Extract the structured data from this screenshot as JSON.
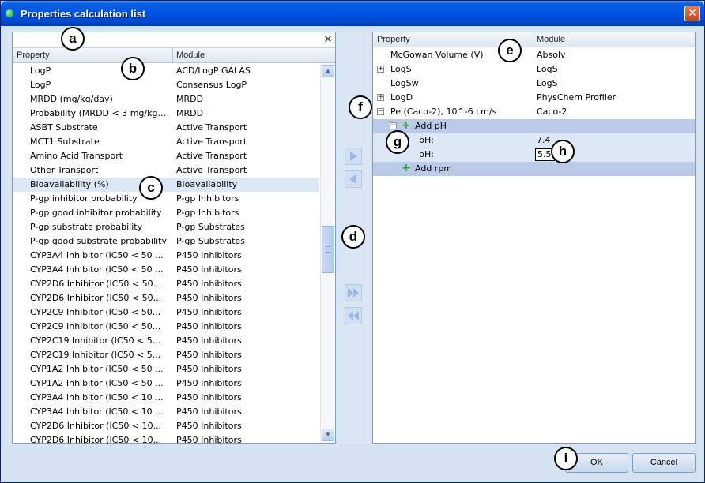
{
  "window": {
    "title": "Properties calculation list",
    "close_glyph": "✕"
  },
  "search": {
    "value": "",
    "clear_glyph": "✕"
  },
  "left_list": {
    "header": {
      "property": "Property",
      "module": "Module"
    },
    "rows": [
      {
        "property": "LogP",
        "module": "ACD/LogP GALAS"
      },
      {
        "property": "LogP",
        "module": "Consensus LogP"
      },
      {
        "property": "MRDD (mg/kg/day)",
        "module": "MRDD"
      },
      {
        "property": "Probability (MRDD < 3 mg/kg...",
        "module": "MRDD"
      },
      {
        "property": "ASBT Substrate",
        "module": "Active Transport"
      },
      {
        "property": "MCT1 Substrate",
        "module": "Active Transport"
      },
      {
        "property": "Amino Acid Transport",
        "module": "Active Transport"
      },
      {
        "property": "Other Transport",
        "module": "Active Transport"
      },
      {
        "property": "Bioavailability (%)",
        "module": "Bioavailability",
        "selected": true
      },
      {
        "property": "P-gp inhibitor probability",
        "module": "P-gp Inhibitors"
      },
      {
        "property": "P-gp good inhibitor probability",
        "module": "P-gp Inhibitors"
      },
      {
        "property": "P-gp substrate probability",
        "module": "P-gp Substrates"
      },
      {
        "property": "P-gp good substrate probability",
        "module": "P-gp Substrates"
      },
      {
        "property": "CYP3A4 Inhibitor (IC50 < 50 ...",
        "module": "P450 Inhibitors"
      },
      {
        "property": "CYP3A4 Inhibitor (IC50 < 50 ...",
        "module": "P450 Inhibitors"
      },
      {
        "property": "CYP2D6 Inhibitor (IC50 < 50...",
        "module": "P450 Inhibitors"
      },
      {
        "property": "CYP2D6 Inhibitor (IC50 < 50...",
        "module": "P450 Inhibitors"
      },
      {
        "property": "CYP2C9 Inhibitor (IC50 < 50...",
        "module": "P450 Inhibitors"
      },
      {
        "property": "CYP2C9 Inhibitor (IC50 < 50...",
        "module": "P450 Inhibitors"
      },
      {
        "property": "CYP2C19 Inhibitor (IC50 < 5...",
        "module": "P450 Inhibitors"
      },
      {
        "property": "CYP2C19 Inhibitor (IC50 < 5...",
        "module": "P450 Inhibitors"
      },
      {
        "property": "CYP1A2 Inhibitor (IC50 < 50 ...",
        "module": "P450 Inhibitors"
      },
      {
        "property": "CYP1A2 Inhibitor (IC50 < 50 ...",
        "module": "P450 Inhibitors"
      },
      {
        "property": "CYP3A4 Inhibitor (IC50 < 10 ...",
        "module": "P450 Inhibitors"
      },
      {
        "property": "CYP3A4 Inhibitor (IC50 < 10 ...",
        "module": "P450 Inhibitors"
      },
      {
        "property": "CYP2D6 Inhibitor (IC50 < 10...",
        "module": "P450 Inhibitors"
      },
      {
        "property": "CYP2D6 Inhibitor (IC50 < 10...",
        "module": "P450 Inhibitors"
      }
    ],
    "scroll_up_glyph": "▲",
    "scroll_down_glyph": "▼"
  },
  "right_list": {
    "header": {
      "property": "Property",
      "module": "Module"
    },
    "rows": [
      {
        "property": "McGowan Volume (V)",
        "module": "Absolv"
      },
      {
        "property": "LogS",
        "module": "LogS",
        "expander": "+"
      },
      {
        "property": "LogSw",
        "module": "LogS"
      },
      {
        "property": "LogD",
        "module": "PhysChem Profiler",
        "expander": "+"
      },
      {
        "property": "Pe (Caco-2), 10^-6 cm/s",
        "module": "Caco-2",
        "expander": "−"
      }
    ],
    "add_ph": {
      "label": "Add pH",
      "expander": "−",
      "icon": "+"
    },
    "ph_rows": [
      {
        "label": "pH:",
        "value": "7.4"
      },
      {
        "label": "pH:",
        "value": "5.5"
      }
    ],
    "add_rpm": {
      "label": "Add rpm",
      "icon": "+"
    }
  },
  "buttons": {
    "ok": "OK",
    "cancel": "Cancel"
  },
  "callouts": [
    "a",
    "b",
    "c",
    "d",
    "e",
    "f",
    "g",
    "h",
    "i"
  ],
  "colors": {
    "title_blue": "#0055e5",
    "selected_row": "#dde8f7",
    "group_row": "#b9cbe9",
    "add_icon": "#2aa52a"
  }
}
